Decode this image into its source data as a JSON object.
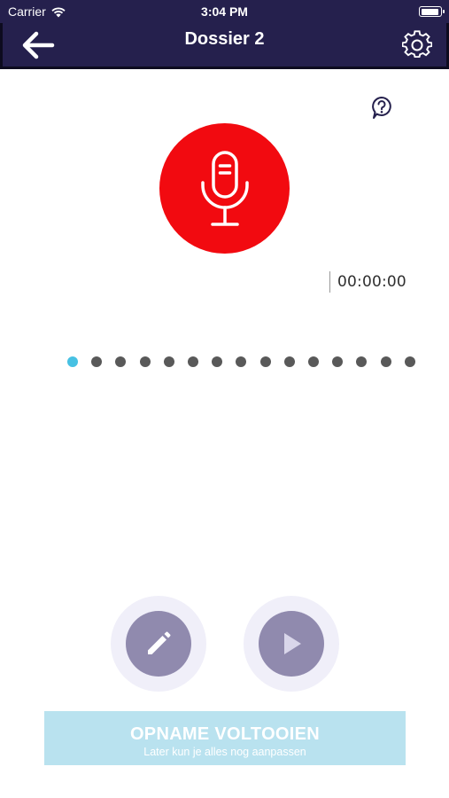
{
  "status_bar": {
    "carrier": "Carrier",
    "time": "3:04 PM",
    "icons": [
      "wifi-icon",
      "battery-icon"
    ]
  },
  "nav": {
    "title": "Dossier 2",
    "back_icon": "arrow-left-icon",
    "settings_icon": "gear-icon"
  },
  "help_icon": "question-bubble-icon",
  "record": {
    "icon": "microphone-icon",
    "color": "#f20a10"
  },
  "timer": "00:00:00",
  "pager": {
    "total": 15,
    "active_index": 0,
    "active_color": "#47c1e3",
    "inactive_color": "#595959"
  },
  "actions": {
    "edit_icon": "pencil-icon",
    "play_icon": "play-icon"
  },
  "finish_button": {
    "title": "OPNAME VOLTOOIEN",
    "subtitle": "Later kun je alles nog aanpassen"
  },
  "colors": {
    "nav_background": "#25204d",
    "action_button": "#908aae",
    "finish_button": "#b9e2ef"
  }
}
